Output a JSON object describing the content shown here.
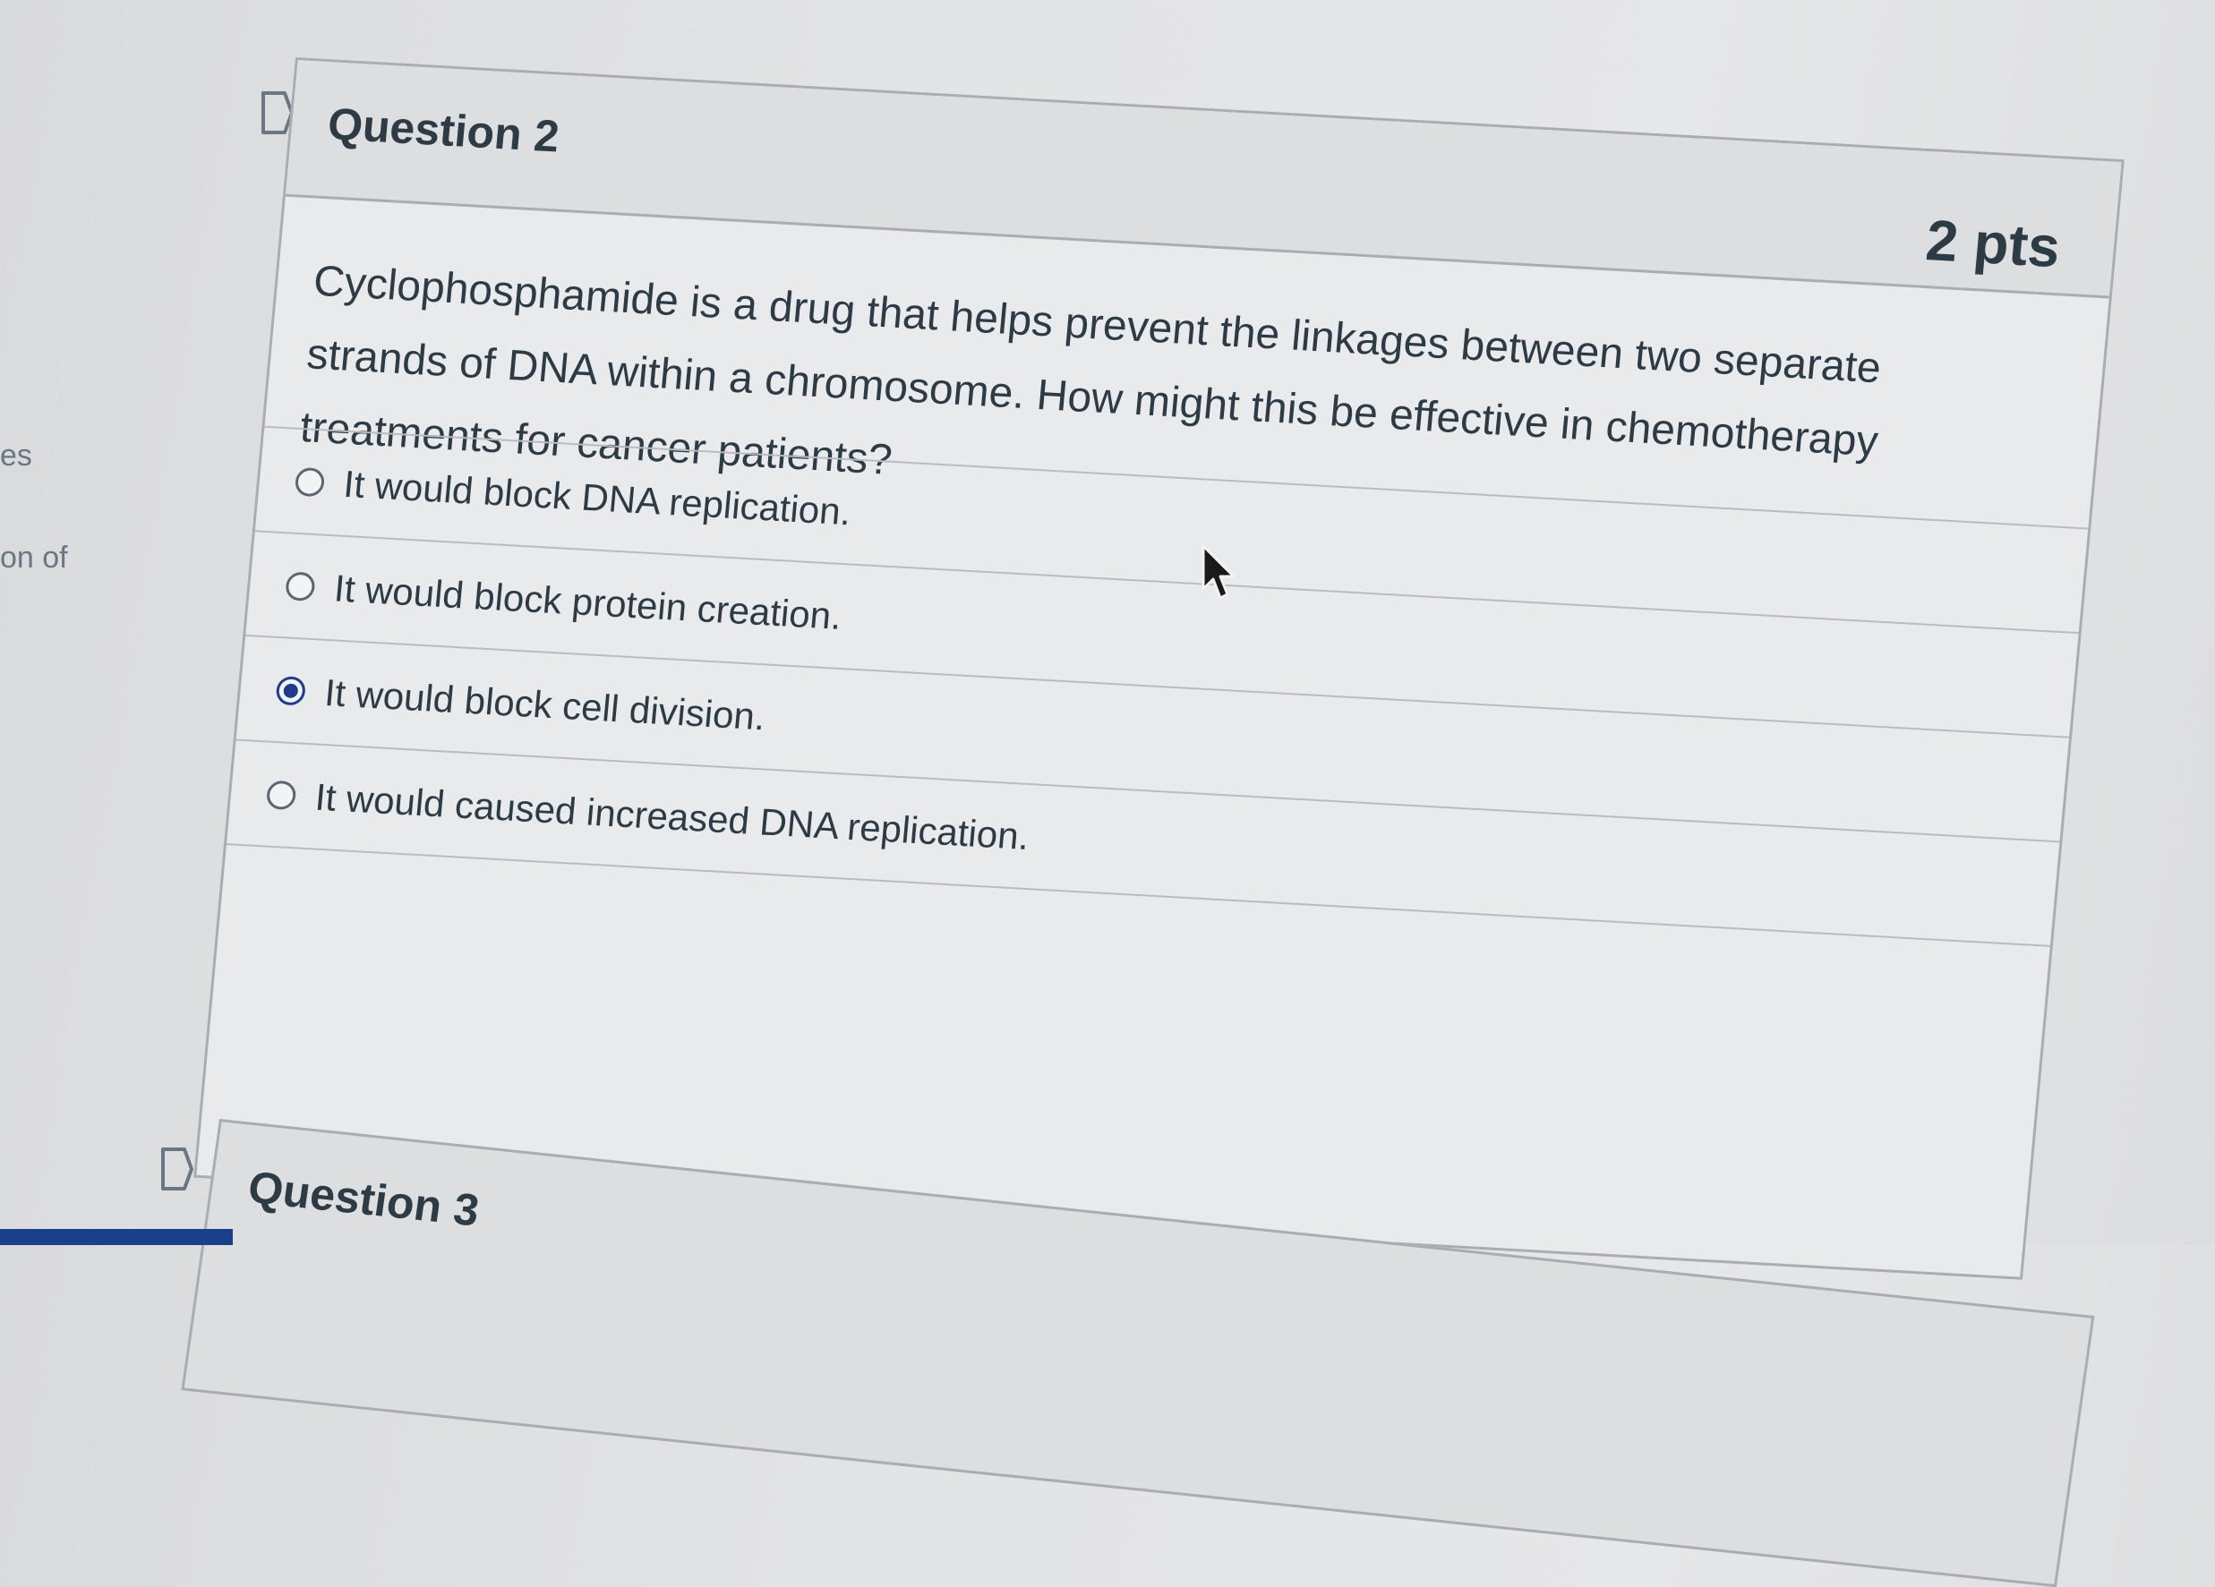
{
  "sidebar": {
    "fragment_1": "es",
    "fragment_2": "on of"
  },
  "question": {
    "title": "Question 2",
    "points": "2 pts",
    "text": "Cyclophosphamide is a drug that helps prevent the linkages between two separate strands of DNA within a chromosome. How might this be effective in chemotherapy treatments for cancer patients?",
    "answers": [
      {
        "label": "It would block DNA replication.",
        "selected": false
      },
      {
        "label": "It would block protein creation.",
        "selected": false
      },
      {
        "label": "It would block cell division.",
        "selected": true
      },
      {
        "label": "It would caused increased DNA replication.",
        "selected": false
      }
    ]
  },
  "next_question": {
    "title": "Question 3"
  },
  "icons": {
    "flag": "bookmark-flag-icon",
    "radio_selected": "radio-selected-icon",
    "radio_unselected": "radio-unselected-icon",
    "cursor": "mouse-pointer-icon"
  },
  "colors": {
    "accent": "#1e3c8c",
    "text": "#2d3b45",
    "border": "#a9adb1"
  }
}
